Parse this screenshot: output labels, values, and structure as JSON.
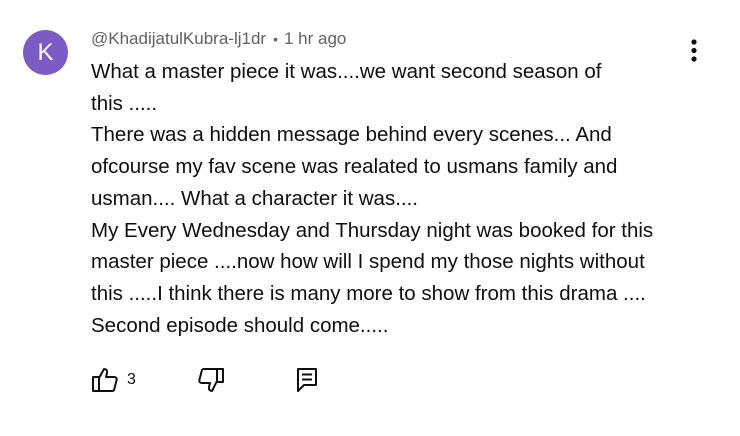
{
  "comment": {
    "avatar_letter": "K",
    "avatar_color": "#7c5cc4",
    "author": "@KhadijatulKubra-lj1dr",
    "separator": "•",
    "timestamp": "1 hr ago",
    "lines": [
      "What a master piece it was....we want second season of",
      "this .....",
      "There was a hidden message behind every scenes... And",
      "ofcourse my fav scene was realated to usmans family and",
      "usman.... What a character it was....",
      "My Every Wednesday and Thursday night was booked for this",
      "master piece ....now how will I spend my those nights without",
      "this .....I think there is many more to show from this drama ....",
      "Second episode should come....."
    ],
    "like_count": "3"
  },
  "icons": {
    "more": "more-vert-icon",
    "like": "thumb-up-icon",
    "dislike": "thumb-down-icon",
    "reply": "reply-icon"
  }
}
